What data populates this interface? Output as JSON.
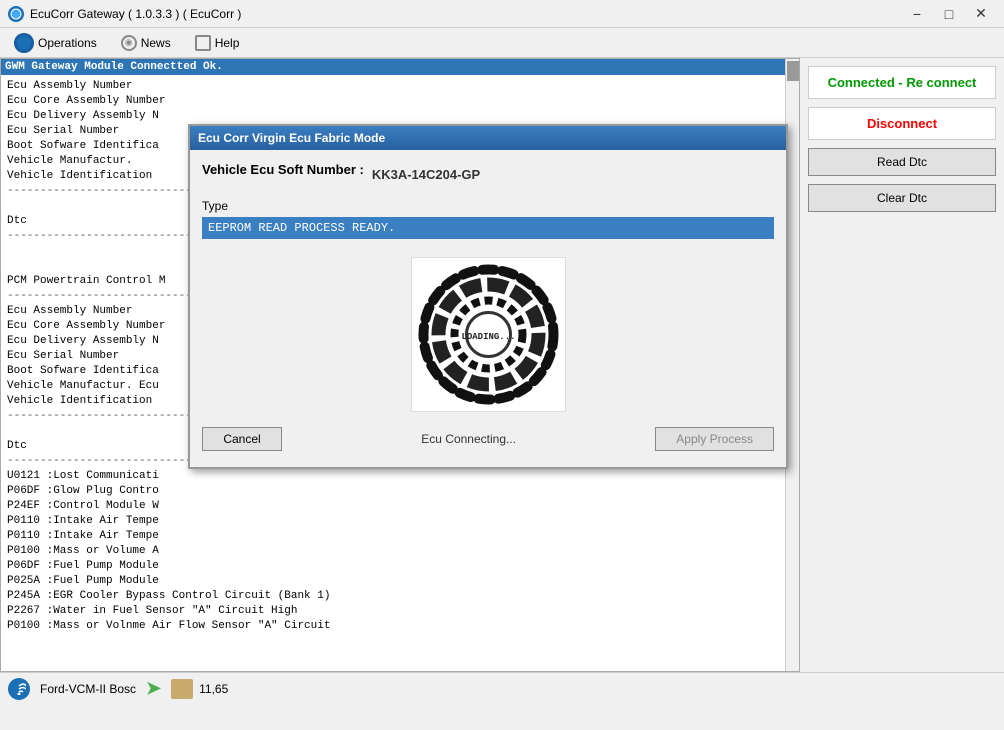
{
  "window": {
    "title": "EcuCorr Gateway ( 1.0.3.3 ) ( EcuCorr )"
  },
  "menu": {
    "operations": "Operations",
    "news": "News",
    "help": "Help"
  },
  "log": {
    "header": "GWM Gateway Module Connectted Ok.",
    "lines": [
      "Ecu Assembly Number",
      "Ecu Core Assembly Number",
      "Ecu Delivery Assembly N",
      "Ecu Serial Number",
      "Boot Sofware Identifica",
      "Vehicle Manufactur.",
      "Vehicle Identification",
      "----------------------------",
      "",
      "Dtc",
      "----------------------------",
      "",
      "",
      "PCM Powertrain Control M",
      "----------------------------",
      "Ecu Assembly Number",
      "Ecu Core Assembly Number",
      "Ecu Delivery Assembly N",
      "Ecu Serial Number",
      "Boot Sofware Identifica",
      "Vehicle Manufactur. Ecu",
      "Vehicle Identification",
      "----------------------------",
      "",
      "Dtc",
      "----------------------------",
      "U0121 :Lost Communicati",
      "P06DF :Glow Plug Contro",
      "P24EF :Control Module W",
      "P0110 :Intake Air Tempe",
      "P0110 :Intake Air Tempe",
      "P0100 :Mass or Volume A",
      "P06DF :Fuel Pump Module",
      "P025A :Fuel Pump Module",
      "P245A :EGR Cooler Bypass Control Circuit (Bank 1)",
      "P2267 :Water in Fuel Sensor \"A\" Circuit High",
      "P0100 :Mass or Volnme Air Flow Sensor \"A\" Circuit"
    ]
  },
  "modal": {
    "title": "Ecu Corr Virgin Ecu Fabric Mode",
    "ecu_label": "Vehicle Ecu Soft Number :",
    "ecu_value": "KK3A-14C204-GP",
    "type_label": "Type",
    "type_value": "EEPROM READ PROCESS READY.",
    "loading_text": "LOADING...",
    "status_text": "Ecu Connecting...",
    "cancel_label": "Cancel",
    "apply_label": "Apply Process"
  },
  "right_panel": {
    "connected_label": "Connected - Re connect",
    "disconnect_label": "Disconnect",
    "read_dtc_label": "Read Dtc",
    "clear_dtc_label": "Clear Dtc"
  },
  "status_bar": {
    "device_name": "Ford-VCM-II Bosc",
    "package_num": "11,65"
  }
}
